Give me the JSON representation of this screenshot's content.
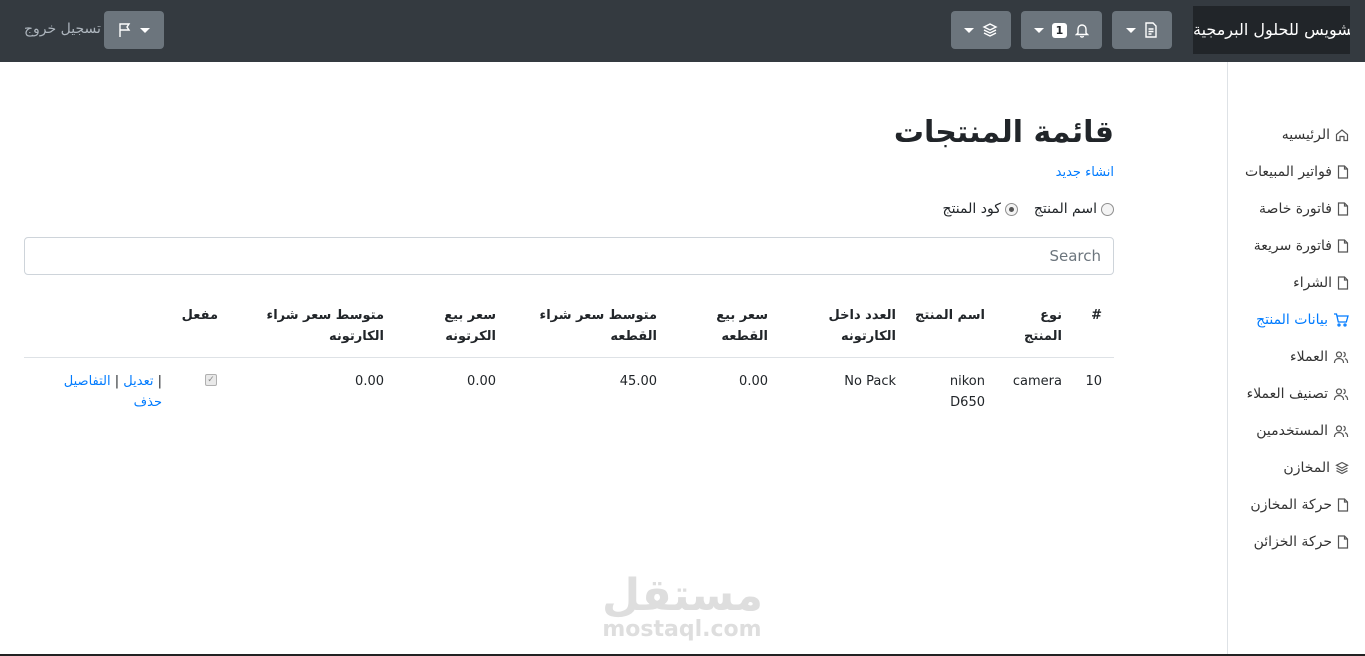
{
  "header": {
    "brand": "تشويس للحلول البرمجية",
    "notifications_count": "1",
    "logout_label": "تسجيل خروج"
  },
  "sidebar": {
    "items": [
      {
        "label": "الرئيسيه",
        "icon": "home-icon"
      },
      {
        "label": "فواتير المبيعات",
        "icon": "file-icon"
      },
      {
        "label": "فاتورة خاصة",
        "icon": "file-icon"
      },
      {
        "label": "فاتورة سريعة",
        "icon": "file-icon"
      },
      {
        "label": "الشراء",
        "icon": "file-icon"
      },
      {
        "label": "بيانات المنتج",
        "icon": "shopping-cart-icon",
        "active": true
      },
      {
        "label": "العملاء",
        "icon": "users-icon"
      },
      {
        "label": "تصنيف العملاء",
        "icon": "users-icon"
      },
      {
        "label": "المستخدمين",
        "icon": "users-icon"
      },
      {
        "label": "المخازن",
        "icon": "layers-icon"
      },
      {
        "label": "حركة المخازن",
        "icon": "file-icon"
      },
      {
        "label": "حركة الخزائن",
        "icon": "file-icon"
      }
    ]
  },
  "main": {
    "title": "قائمة المنتجات",
    "create_link": "انشاء جديد",
    "search_by": {
      "options": [
        "اسم المنتج",
        "كود المنتج"
      ],
      "selected": "كود المنتج"
    },
    "search_placeholder": "Search"
  },
  "table": {
    "headers": [
      {
        "line1": "#",
        "line2": ""
      },
      {
        "line1": "نوع",
        "line2": "المنتج"
      },
      {
        "line1": "اسم المنتج",
        "line2": ""
      },
      {
        "line1": "العدد داخل",
        "line2": "الكارتونه"
      },
      {
        "line1": "سعر بيع",
        "line2": "القطعه"
      },
      {
        "line1": "متوسط سعر شراء",
        "line2": "القطعه"
      },
      {
        "line1": "سعر بيع",
        "line2": "الكرتونه"
      },
      {
        "line1": "متوسط سعر شراء",
        "line2": "الكارتونه"
      },
      {
        "line1": "مفعل",
        "line2": ""
      }
    ],
    "rows": [
      {
        "id": "10",
        "type": "camera",
        "name_line1": "nikon",
        "name_line2": "D650",
        "pieces_per_carton": "No Pack",
        "piece_sell_price": "0.00",
        "avg_piece_buy_price": "45.00",
        "carton_sell_price": "0.00",
        "avg_carton_buy_price": "0.00",
        "active": true,
        "actions": {
          "edit": "تعديل",
          "details": "التفاصيل",
          "delete": "حذف",
          "separator": "|"
        }
      }
    ]
  },
  "watermark": {
    "arabic": "مستقل",
    "latin": "mostaql.com"
  }
}
